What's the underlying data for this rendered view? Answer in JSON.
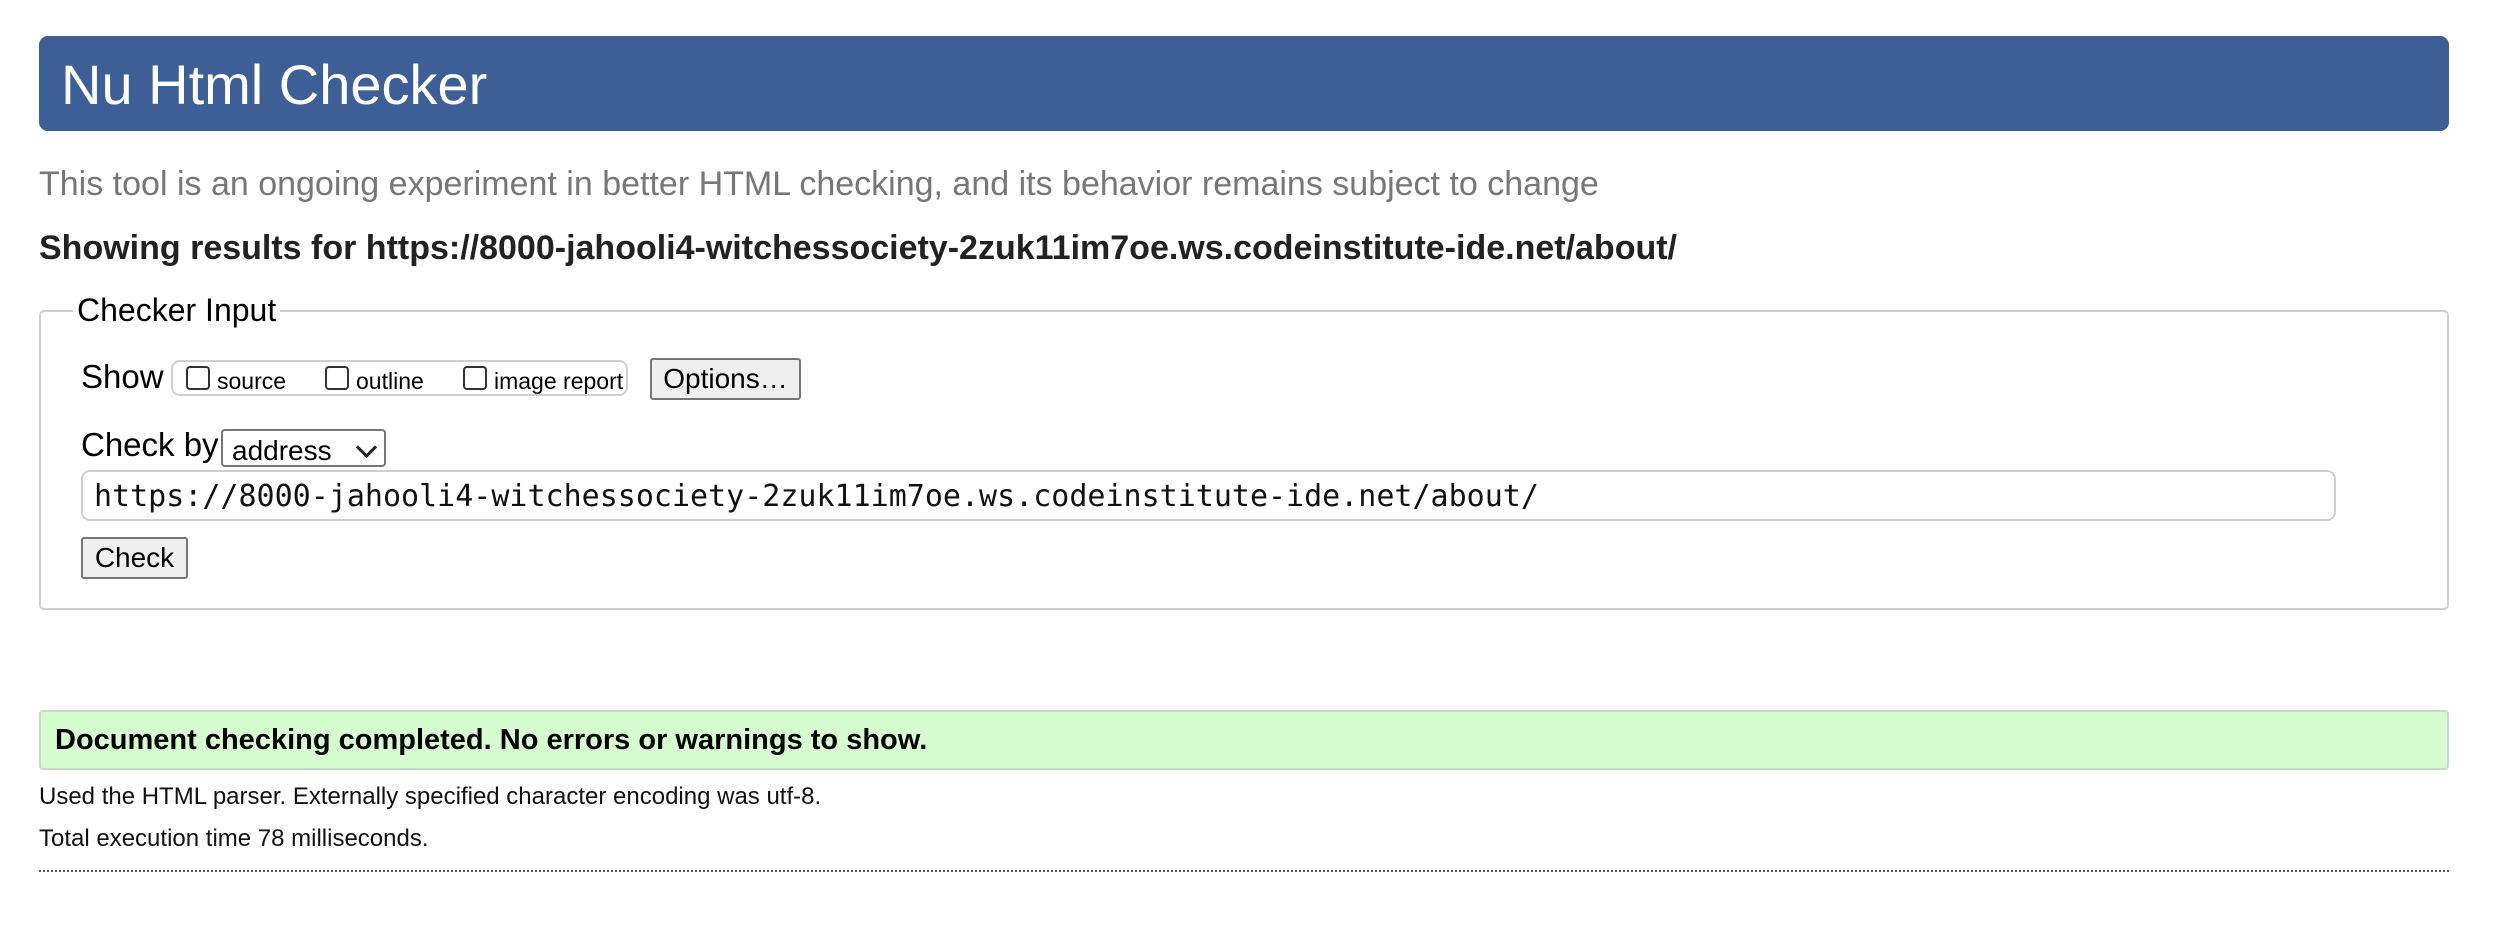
{
  "header": {
    "title": "Nu Html Checker"
  },
  "subtitle": "This tool is an ongoing experiment in better HTML checking, and its behavior remains subject to change",
  "results_heading": "Showing results for https://8000-jahooli4-witchessociety-2zuk11im7oe.ws.codeinstitute-ide.net/about/",
  "checker_input": {
    "legend": "Checker Input",
    "show_label": "Show",
    "show_options": [
      {
        "label": "source",
        "checked": false
      },
      {
        "label": "outline",
        "checked": false
      },
      {
        "label": "image report",
        "checked": false
      }
    ],
    "options_button": "Options…",
    "check_by_label": "Check by",
    "check_by_value": "address",
    "url_value": "https://8000-jahooli4-witchessociety-2zuk11im7oe.ws.codeinstitute-ide.net/about/",
    "check_button": "Check"
  },
  "result": {
    "message": "Document checking completed. No errors or warnings to show.",
    "info_lines": [
      "Used the HTML parser. Externally specified character encoding was utf-8.",
      "Total execution time 78 milliseconds."
    ]
  },
  "colors": {
    "header_bg": "#3e5f96",
    "success_bg": "#d6fdd0",
    "subtitle_text": "#777777"
  }
}
